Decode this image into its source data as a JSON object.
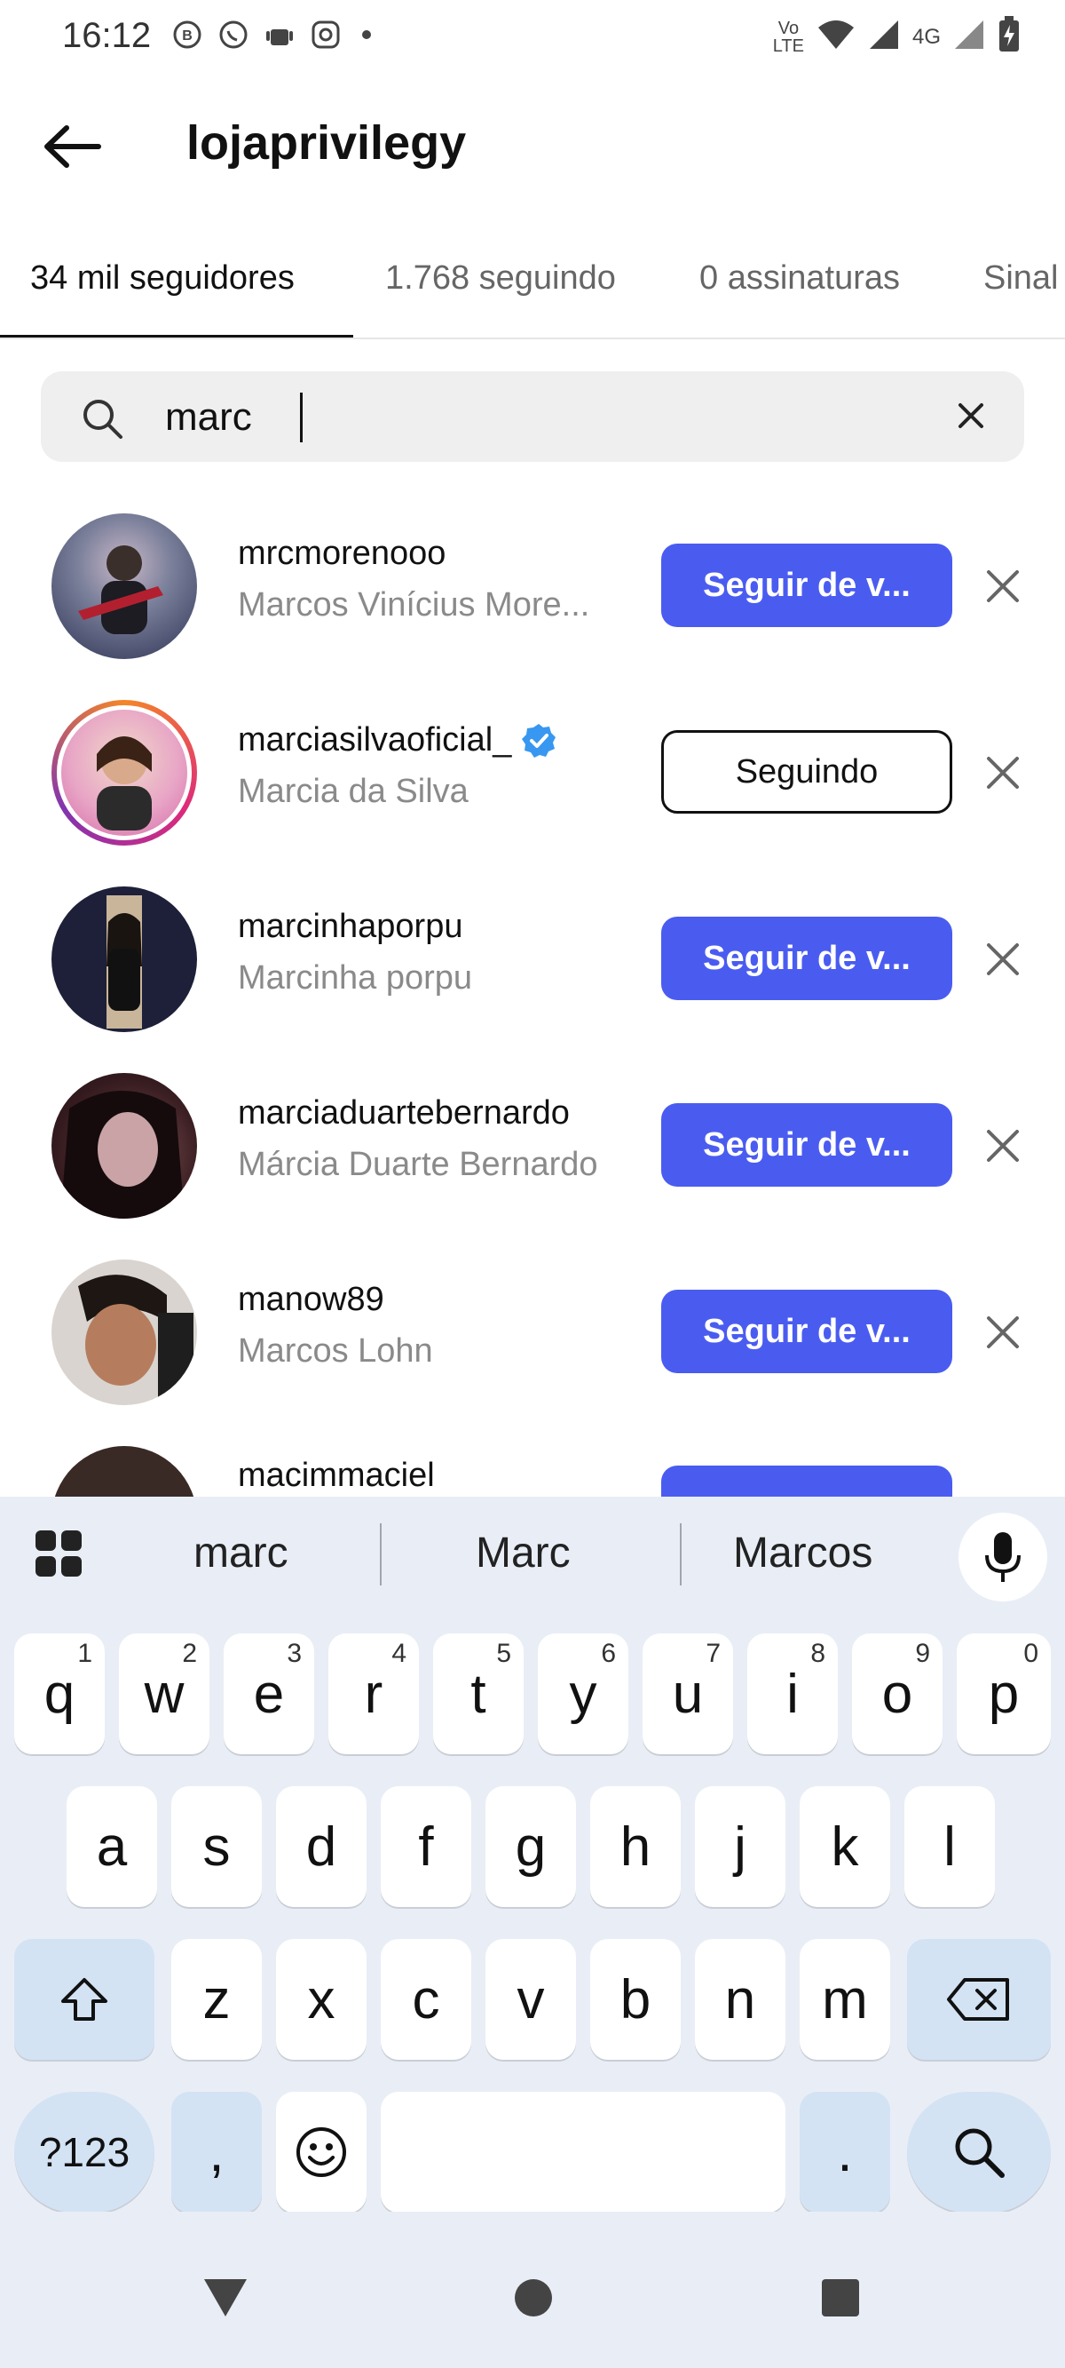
{
  "status_bar": {
    "time": "16:12",
    "lte_label_top": "Vo",
    "lte_label_bottom": "LTE",
    "network": "4G",
    "left_icons": [
      "whatsapp-business-icon",
      "whatsapp-icon",
      "android-icon",
      "instagram-icon"
    ],
    "right_icons": [
      "wifi-icon",
      "signal-icon",
      "battery-charging-icon"
    ]
  },
  "header": {
    "title": "lojaprivilegy",
    "back_icon": "arrow-left-icon"
  },
  "tabs": [
    {
      "label": "34 mil seguidores",
      "active": true
    },
    {
      "label": "1.768 seguindo",
      "active": false
    },
    {
      "label": "0 assinaturas",
      "active": false
    },
    {
      "label": "Sinal",
      "active": false
    }
  ],
  "search": {
    "value": "marc",
    "icon": "search-icon",
    "clear_icon": "close-icon"
  },
  "results": [
    {
      "username": "mrcmorenooo",
      "full_name": "Marcos Vinícius More...",
      "verified": false,
      "button": "Seguir de v...",
      "following": false
    },
    {
      "username": "marciasilvaoficial_",
      "full_name": "Marcia da Silva",
      "verified": true,
      "button": "Seguindo",
      "following": true
    },
    {
      "username": "marcinhaporpu",
      "full_name": "Marcinha porpu",
      "verified": false,
      "button": "Seguir de v...",
      "following": false
    },
    {
      "username": "marciaduartebernardo",
      "full_name": "Márcia Duarte Bernardo",
      "verified": false,
      "button": "Seguir de v...",
      "following": false
    },
    {
      "username": "manow89",
      "full_name": "Marcos Lohn",
      "verified": false,
      "button": "Seguir de v...",
      "following": false
    },
    {
      "username": "macimmaciel",
      "full_name": "",
      "verified": false,
      "button": "",
      "following": false
    }
  ],
  "keyboard": {
    "suggestions": [
      "marc",
      "Marc",
      "Marcos"
    ],
    "row1": [
      {
        "k": "q",
        "n": "1"
      },
      {
        "k": "w",
        "n": "2"
      },
      {
        "k": "e",
        "n": "3"
      },
      {
        "k": "r",
        "n": "4"
      },
      {
        "k": "t",
        "n": "5"
      },
      {
        "k": "y",
        "n": "6"
      },
      {
        "k": "u",
        "n": "7"
      },
      {
        "k": "i",
        "n": "8"
      },
      {
        "k": "o",
        "n": "9"
      },
      {
        "k": "p",
        "n": "0"
      }
    ],
    "row2": [
      "a",
      "s",
      "d",
      "f",
      "g",
      "h",
      "j",
      "k",
      "l"
    ],
    "row3": [
      "z",
      "x",
      "c",
      "v",
      "b",
      "n",
      "m"
    ],
    "symbols_key": "?123",
    "comma_key": ",",
    "period_key": "."
  },
  "colors": {
    "follow_button": "#4a5cf0",
    "verified_badge": "#3897f0",
    "keyboard_bg": "#e9eef6",
    "function_key": "#d3e3f4"
  }
}
